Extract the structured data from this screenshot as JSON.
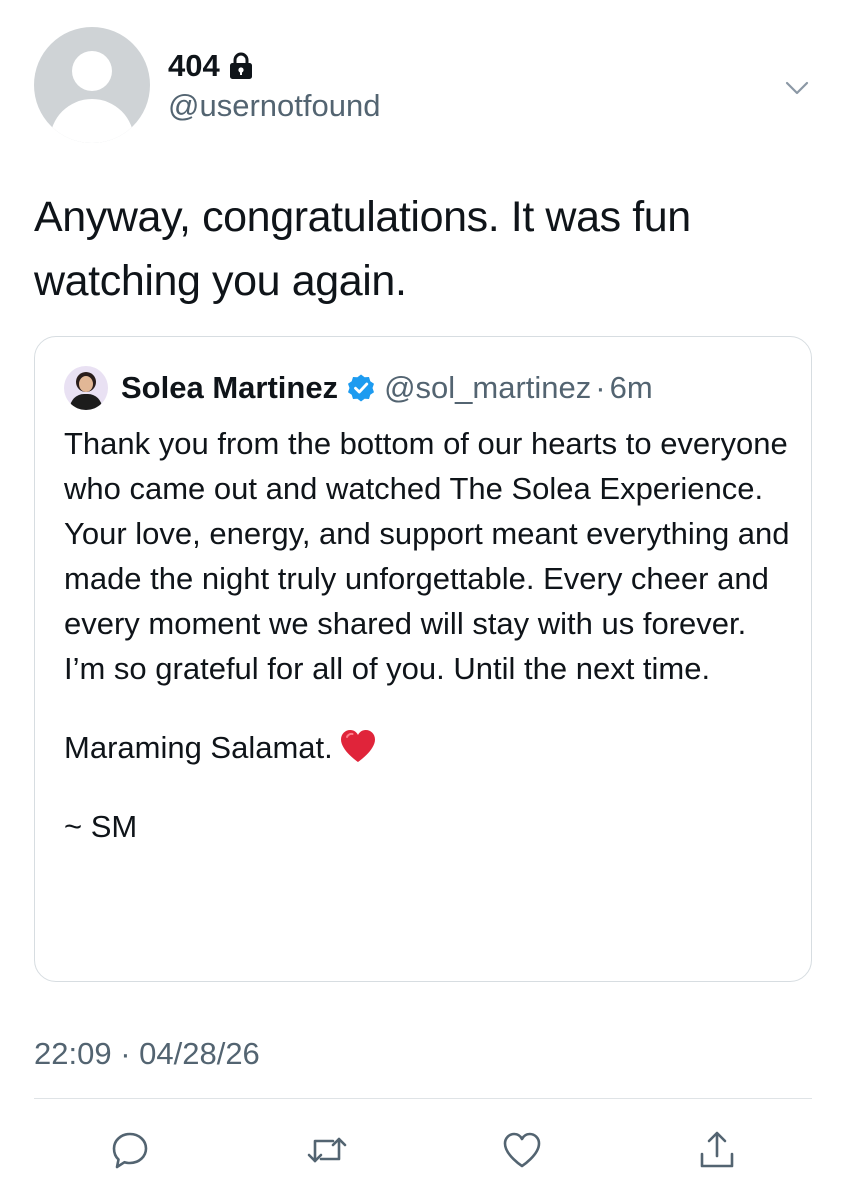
{
  "author": {
    "display_name": "404",
    "handle": "@usernotfound",
    "protected_icon": "lock-icon"
  },
  "tweet": {
    "text": "Anyway, congratulations. It was fun watching you again.",
    "timestamp": "22:09 · 04/28/26"
  },
  "quoted_tweet": {
    "display_name": "Solea Martinez",
    "verified_icon": "verified-badge-icon",
    "handle": "@sol_martinez",
    "separator": "·",
    "time": "6m",
    "paragraphs": [
      "Thank you from the bottom of our hearts to everyone who came out and watched The Solea Experience. Your love, energy, and support meant everything and made the night truly unforgettable. Every cheer and every moment we shared will stay with us forever. I’m so grateful for all of you. Until the next time.",
      "Maraming Salamat.",
      "~ SM"
    ],
    "emoji": "red-heart-emoji"
  },
  "actions": {
    "reply_icon": "reply-icon",
    "retweet_icon": "retweet-icon",
    "like_icon": "like-icon",
    "share_icon": "share-icon"
  },
  "colors": {
    "text_primary": "#0f1419",
    "text_secondary": "#536471",
    "verified_blue": "#1d9bf0",
    "heart_red": "#e0243a",
    "border": "#d7dde1"
  }
}
